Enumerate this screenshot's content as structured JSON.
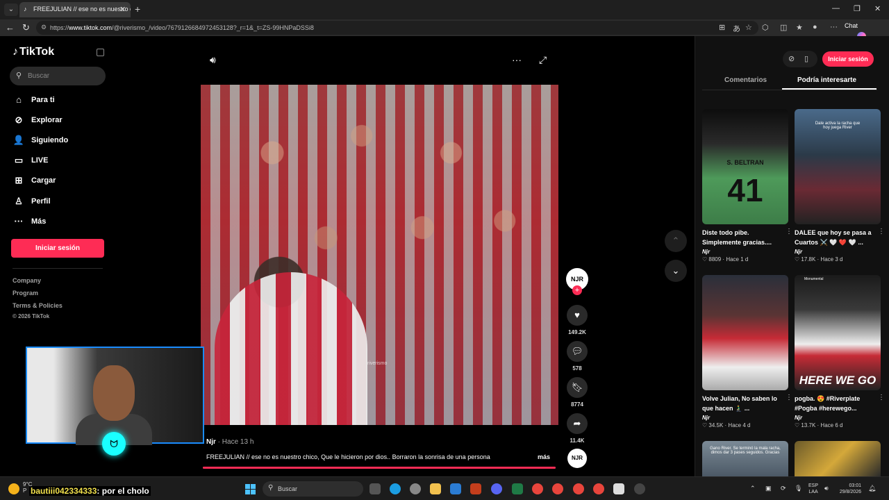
{
  "browser": {
    "tab_title": "FREEJULIAN // ese no es nuestro c",
    "url_prefix": "https://",
    "url_domain": "www.tiktok.com",
    "url_path": "/@riverismo_/video/7679126684972453128?_r=1&_t=ZS-99HNPaDSSi8",
    "chat_label": "Chat"
  },
  "sidebar": {
    "logo": "TikTok",
    "search_placeholder": "Buscar",
    "nav": [
      {
        "label": "Para ti",
        "icon": "home-icon"
      },
      {
        "label": "Explorar",
        "icon": "compass-icon"
      },
      {
        "label": "Siguiendo",
        "icon": "following-icon"
      },
      {
        "label": "LIVE",
        "icon": "live-icon"
      },
      {
        "label": "Cargar",
        "icon": "upload-icon"
      },
      {
        "label": "Perfil",
        "icon": "profile-icon"
      },
      {
        "label": "Más",
        "icon": "more-icon"
      }
    ],
    "login_label": "Iniciar sesión",
    "footer_links": [
      "Company",
      "Program",
      "Terms & Policies"
    ],
    "copyright": "© 2026 TikTok"
  },
  "video": {
    "author": "Njr",
    "time": " · Hace 13 h",
    "caption": "FREEJULIAN // ese no es nuestro chico, Que le hicieron por dios.. Borraron la sonrisa de una persona",
    "more_label": "más",
    "watermark": "riverismo",
    "progress_percent": 100,
    "avatar_text": "NJR",
    "likes": "149.2K",
    "comments": "578",
    "saves": "8774",
    "shares": "11.4K"
  },
  "panel": {
    "login_label": "Iniciar sesión",
    "tab_comments": "Comentarios",
    "tab_suggest": "Podría interesarte",
    "cards": [
      {
        "title": "Diste todo pibe. Simplemente gracias....",
        "author": "Njr",
        "likes": "8809",
        "time": "Hace 1 d",
        "thumb_text": "S. BELTRAN",
        "thumb_big": "41"
      },
      {
        "title": "DALEE que hoy se pasa a Cuartos ⚔️ 🤍 ❤️ 🤍 ...",
        "author": "Njr",
        "likes": "17.8K",
        "time": "Hace 3 d",
        "thumb_text": "Dale activa la racha que hoy juega River",
        "thumb_big": ""
      },
      {
        "title": "Volve Julian, No saben lo que hacen 🧎‍♂️ ...",
        "author": "Njr",
        "likes": "34.5K",
        "time": "Hace 4 d",
        "thumb_text": "",
        "thumb_big": ""
      },
      {
        "title": "pogba. 😍 #Riverplate #Pogba #herewego...",
        "author": "Njr",
        "likes": "13.7K",
        "time": "Hace 6 d",
        "thumb_text": "Monumental",
        "thumb_big": "HERE WE GO"
      },
      {
        "title": "",
        "author": "",
        "likes": "",
        "time": "",
        "thumb_text": "Gano River. Se terminó la mala racha, dimos dar 3 pases seguidos. Gracias",
        "thumb_big": ""
      },
      {
        "title": "",
        "author": "",
        "likes": "",
        "time": "",
        "thumb_text": "",
        "thumb_big": ""
      }
    ]
  },
  "overlay": {
    "chat_user": "bautiii042334333",
    "chat_msg": ": por el cholo"
  },
  "taskbar": {
    "weather_temp": "9°C",
    "weather_desc": "P",
    "search_placeholder": "Buscar",
    "lang1": "ESP",
    "lang2": "LAA",
    "time": "03:01",
    "date": "29/8/2026"
  },
  "colors": {
    "accent": "#fe2c55",
    "webcam_border": "#1a8cff"
  }
}
